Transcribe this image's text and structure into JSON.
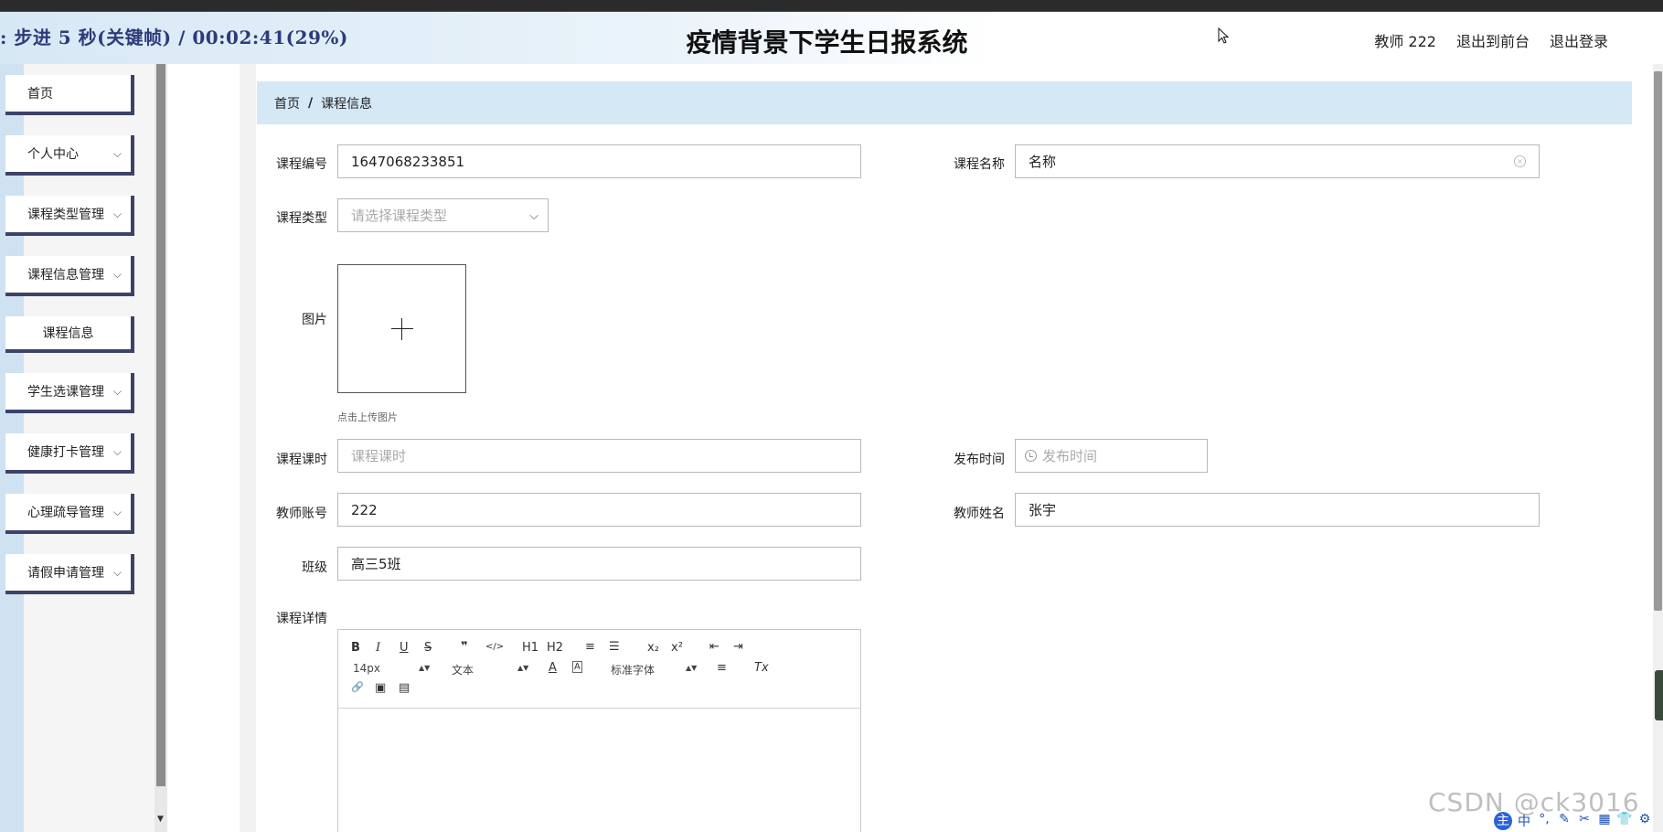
{
  "overlay": {
    "progress_text": ": 步进 5 秒(关键帧) / 00:02:41(29%)"
  },
  "header": {
    "title": "疫情背景下学生日报系统",
    "user_label": "教师 222",
    "front_link": "退出到前台",
    "logout_link": "退出登录"
  },
  "sidebar": {
    "items": [
      {
        "label": "首页"
      },
      {
        "label": "个人中心"
      },
      {
        "label": "课程类型管理"
      },
      {
        "label": "课程信息管理"
      },
      {
        "label": "课程信息"
      },
      {
        "label": "学生选课管理"
      },
      {
        "label": "健康打卡管理"
      },
      {
        "label": "心理疏导管理"
      },
      {
        "label": "请假申请管理"
      }
    ]
  },
  "breadcrumb": {
    "home": "首页",
    "sep": "/",
    "current": "课程信息"
  },
  "form": {
    "course_no": {
      "label": "课程编号",
      "value": "1647068233851"
    },
    "course_name": {
      "label": "课程名称",
      "value": "名称"
    },
    "course_type": {
      "label": "课程类型",
      "placeholder": "请选择课程类型"
    },
    "image": {
      "label": "图片",
      "hint": "点击上传图片"
    },
    "course_hours": {
      "label": "课程课时",
      "placeholder": "课程课时"
    },
    "publish_time": {
      "label": "发布时间",
      "placeholder": "发布时间"
    },
    "teacher_account": {
      "label": "教师账号",
      "value": "222"
    },
    "teacher_name": {
      "label": "教师姓名",
      "value": "张宇"
    },
    "class": {
      "label": "班级",
      "value": "高三5班"
    },
    "details": {
      "label": "课程详情"
    }
  },
  "editor": {
    "bold": "B",
    "italic": "I",
    "underline": "U",
    "strike": "S",
    "quote": "❞",
    "code": "</>",
    "h1": "H1",
    "h2": "H2",
    "ol": "≡",
    "ul": "☰",
    "sub": "x₂",
    "sup": "x²",
    "outdent": "⇤",
    "indent": "⇥",
    "size": "14px",
    "format": "文本",
    "font": "标准字体",
    "color": "A",
    "bg": "A",
    "align": "≡",
    "clear": "Tx",
    "link": "🔗",
    "image": "▣",
    "video": "▤"
  },
  "watermark": "CSDN @ck3016",
  "ime": [
    "主",
    "中",
    "°,",
    "✎",
    "✂",
    "▦",
    "👕",
    "⚙"
  ]
}
